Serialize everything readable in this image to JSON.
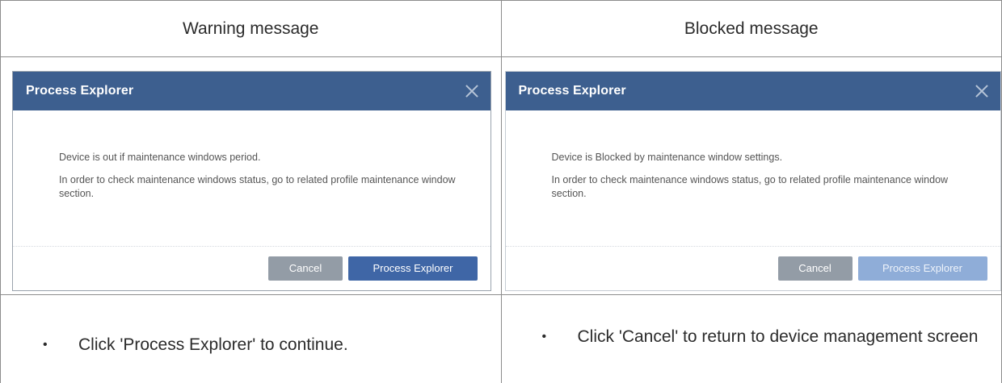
{
  "columns": [
    {
      "heading": "Warning message",
      "dialog": {
        "title": "Process Explorer",
        "line1": "Device is out if maintenance windows period.",
        "line2": "In order to check maintenance windows status, go to related profile maintenance window section.",
        "cancel_label": "Cancel",
        "primary_label": "Process Explorer",
        "primary_enabled": true
      },
      "note": {
        "bullet": "•",
        "text": "Click 'Process Explorer' to continue."
      }
    },
    {
      "heading": "Blocked message",
      "dialog": {
        "title": "Process Explorer",
        "line1": "Device is Blocked by maintenance window settings.",
        "line2": "In order to check maintenance windows status, go to related profile maintenance window section.",
        "cancel_label": "Cancel",
        "primary_label": "Process Explorer",
        "primary_enabled": false
      },
      "note": {
        "bullet": "•",
        "text": "Click 'Cancel' to return to device management screen"
      }
    }
  ],
  "colors": {
    "header_bg": "#3d5f8f",
    "primary_button": "#3f66a6",
    "primary_button_disabled": "#8fadd8",
    "cancel_button": "#939ca6"
  },
  "icons": {
    "close": "close-icon"
  }
}
